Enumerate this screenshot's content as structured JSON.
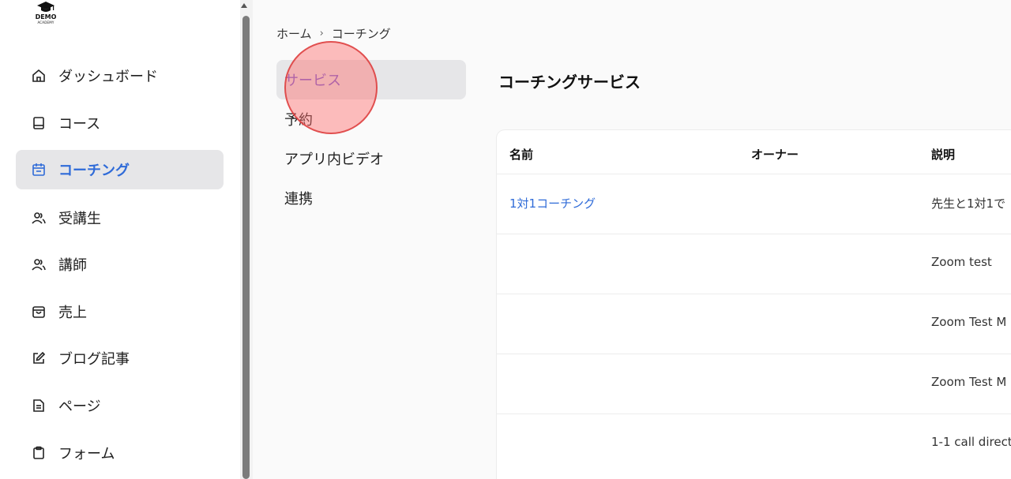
{
  "logo": {
    "line1": "DEMO",
    "line2": "ACADEMY",
    "icon": "graduation-cap-icon"
  },
  "sidebar": {
    "items": [
      {
        "label": "ダッシュボード",
        "icon": "home-icon"
      },
      {
        "label": "コース",
        "icon": "book-icon"
      },
      {
        "label": "コーチング",
        "icon": "calendar-icon",
        "active": true
      },
      {
        "label": "受講生",
        "icon": "users-icon"
      },
      {
        "label": "講師",
        "icon": "users-icon"
      },
      {
        "label": "売上",
        "icon": "shopping-bag-icon"
      },
      {
        "label": "ブログ記事",
        "icon": "edit-icon"
      },
      {
        "label": "ページ",
        "icon": "file-text-icon"
      },
      {
        "label": "フォーム",
        "icon": "clipboard-icon"
      }
    ]
  },
  "breadcrumb": {
    "home": "ホーム",
    "separator": "›",
    "current": "コーチング"
  },
  "subnav": {
    "items": [
      {
        "label": "サービス",
        "active": true
      },
      {
        "label": "予約"
      },
      {
        "label": "アプリ内ビデオ"
      },
      {
        "label": "連携"
      }
    ]
  },
  "main": {
    "title": "コーチングサービス"
  },
  "table": {
    "headers": {
      "name": "名前",
      "owner": "オーナー",
      "description": "説明"
    },
    "rows": [
      {
        "name": "1対1コーチング",
        "owner": "",
        "description": "先生と1対1で"
      },
      {
        "name": "",
        "owner": "",
        "description": "Zoom test"
      },
      {
        "name": "",
        "owner": "",
        "description": "Zoom Test M"
      },
      {
        "name": "",
        "owner": "",
        "description": "Zoom Test M"
      },
      {
        "name": "",
        "owner": "",
        "description": "1-1 call direct"
      }
    ]
  },
  "colors": {
    "accent": "#2f6bd8",
    "subnav_active": "#6f5ad6",
    "active_bg": "#e6e6e8",
    "click_indicator": "#ff6e6e"
  }
}
